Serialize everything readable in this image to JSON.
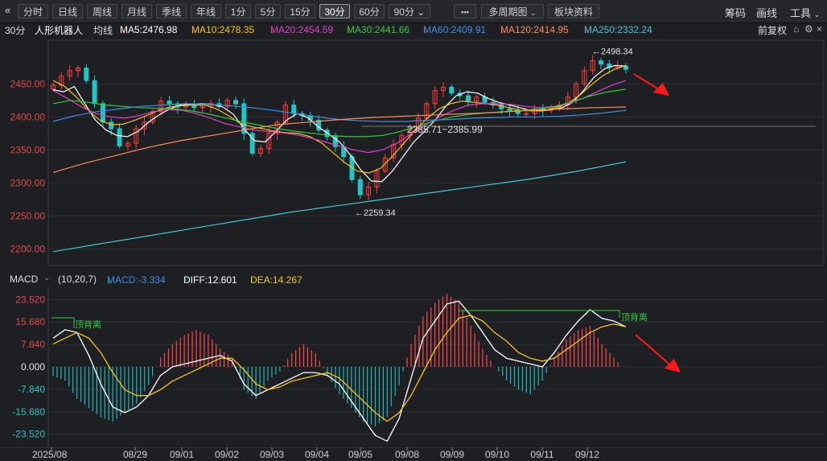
{
  "toolbar": {
    "collapse_icon": "double-chevron-left-icon",
    "periods": [
      "分时",
      "日线",
      "周线",
      "月线",
      "季线",
      "年线",
      "1分",
      "5分",
      "15分",
      "30分",
      "60分",
      "90分"
    ],
    "active_period": "30分",
    "more_label": "▪▪▪",
    "multi_period": "多周期图",
    "sector_info": "板块资料",
    "right": [
      "筹码",
      "画线",
      "工具"
    ]
  },
  "info": {
    "period": "30分",
    "name": "人形机器人",
    "ma_label": "均线",
    "ma": [
      {
        "label": "MA5:2476.98",
        "color": "#ffffff",
        "arrow": "↑"
      },
      {
        "label": "MA10:2478.35",
        "color": "#f5c518",
        "arrow": "↑"
      },
      {
        "label": "MA20:2454.59",
        "color": "#e040c8",
        "arrow": "↑"
      },
      {
        "label": "MA30:2441.66",
        "color": "#2ecc40",
        "arrow": "↑"
      },
      {
        "label": "MA60:2409.91",
        "color": "#3a8ee6",
        "arrow": "↑"
      },
      {
        "label": "MA120:2414.95",
        "color": "#ff8c5a",
        "arrow": "↑"
      },
      {
        "label": "MA250:2332.24",
        "color": "#40c8d8",
        "arrow": "↑"
      }
    ],
    "adjust": "前复权"
  },
  "macd": {
    "name": "MACD",
    "params": "(10,20,7)",
    "macd": "MACD:-3.334",
    "macd_arrow": "↓",
    "diff": "DIFF:12.601",
    "diff_arrow": "↓",
    "dea": "DEA:14.267",
    "dea_arrow": "↓"
  },
  "annotations": {
    "high": "←2498.34",
    "low": "←2259.34",
    "mid": "2385.71~2385.99",
    "top_div_1": "顶背离",
    "top_div_2": "顶背离"
  },
  "colors": {
    "up": "#ff3b3b",
    "down": "#22c5c5",
    "bg": "#1e1f23",
    "grid": "#2e2f35"
  },
  "chart_data": [
    {
      "type": "candlestick",
      "title": "30分 人形机器人",
      "yticks": [
        "2450.00",
        "2400.00",
        "2350.00",
        "2300.00",
        "2250.00",
        "2200.00"
      ],
      "yvals": [
        2450,
        2400,
        2350,
        2300,
        2250,
        2200
      ],
      "ylim": [
        2175,
        2510
      ],
      "xticks": [
        "2025/08",
        "08/29",
        "09/01",
        "09/02",
        "09/03",
        "09/04",
        "09/05",
        "09/08",
        "09/09",
        "09/10",
        "09/11",
        "09/12"
      ],
      "high_label_value": 2498.34,
      "low_label_value": 2259.34,
      "close_path": [
        2448,
        2462,
        2470,
        2474,
        2455,
        2420,
        2392,
        2382,
        2356,
        2360,
        2382,
        2392,
        2408,
        2424,
        2420,
        2415,
        2418,
        2414,
        2416,
        2420,
        2416,
        2425,
        2420,
        2375,
        2345,
        2352,
        2375,
        2392,
        2418,
        2405,
        2402,
        2395,
        2380,
        2370,
        2355,
        2340,
        2305,
        2282,
        2294,
        2318,
        2338,
        2358,
        2372,
        2382,
        2398,
        2420,
        2440,
        2445,
        2436,
        2432,
        2424,
        2430,
        2422,
        2418,
        2412,
        2410,
        2405,
        2405,
        2412,
        2410,
        2415,
        2418,
        2430,
        2450,
        2470,
        2485,
        2480,
        2475,
        2477,
        2472
      ],
      "ma_series": [
        {
          "name": "MA5",
          "values": [
            2441,
            2438,
            2446,
            2420,
            2395,
            2380,
            2372,
            2370,
            2378,
            2392,
            2403,
            2412,
            2418,
            2419,
            2420,
            2419,
            2415,
            2404,
            2382,
            2364,
            2362,
            2378,
            2395,
            2405,
            2399,
            2385,
            2374,
            2362,
            2343,
            2320,
            2303,
            2302,
            2318,
            2340,
            2362,
            2378,
            2395,
            2416,
            2432,
            2438,
            2436,
            2428,
            2422,
            2418,
            2414,
            2410,
            2409,
            2411,
            2414,
            2422,
            2440,
            2460,
            2473,
            2478,
            2477
          ],
          "xr": [
            0.0,
            1.0
          ]
        },
        {
          "name": "MA10",
          "values": [
            2455,
            2446,
            2430,
            2410,
            2395,
            2388,
            2389,
            2395,
            2402,
            2410,
            2415,
            2417,
            2418,
            2418,
            2412,
            2402,
            2390,
            2385,
            2382,
            2378,
            2376,
            2375,
            2370,
            2360,
            2345,
            2330,
            2318,
            2315,
            2322,
            2340,
            2360,
            2380,
            2398,
            2412,
            2420,
            2424,
            2422,
            2420,
            2418,
            2414,
            2410,
            2409,
            2410,
            2414,
            2420,
            2432,
            2448,
            2462,
            2472,
            2478
          ],
          "xr": [
            0.0,
            1.0
          ]
        },
        {
          "name": "MA20",
          "values": [
            2440,
            2428,
            2415,
            2405,
            2400,
            2398,
            2402,
            2408,
            2411,
            2410,
            2405,
            2398,
            2390,
            2385,
            2380,
            2378,
            2376,
            2373,
            2368,
            2362,
            2356,
            2350,
            2346,
            2350,
            2360,
            2374,
            2388,
            2400,
            2410,
            2418,
            2420,
            2420,
            2419,
            2416,
            2414,
            2416,
            2420,
            2428,
            2438,
            2448,
            2455
          ],
          "xr": [
            0.0,
            1.0
          ]
        },
        {
          "name": "MA30",
          "values": [
            2420,
            2425,
            2422,
            2418,
            2416,
            2414,
            2413,
            2412,
            2409,
            2404,
            2398,
            2392,
            2387,
            2382,
            2378,
            2375,
            2372,
            2370,
            2370,
            2372,
            2378,
            2386,
            2394,
            2400,
            2404,
            2406,
            2408,
            2410,
            2412,
            2416,
            2424,
            2432,
            2438,
            2442
          ],
          "xr": [
            0.0,
            1.0
          ]
        },
        {
          "name": "MA60",
          "values": [
            2393,
            2402,
            2408,
            2412,
            2416,
            2418,
            2420,
            2419,
            2417,
            2414,
            2410,
            2405,
            2400,
            2396,
            2394,
            2393,
            2393,
            2395,
            2396,
            2398,
            2399,
            2400,
            2400,
            2401,
            2403,
            2406,
            2410
          ],
          "xr": [
            0.0,
            1.0
          ]
        },
        {
          "name": "MA120",
          "values": [
            2316,
            2330,
            2342,
            2354,
            2364,
            2372,
            2380,
            2388,
            2392,
            2396,
            2399,
            2401,
            2403,
            2405,
            2407,
            2410,
            2412,
            2414,
            2415
          ],
          "xr": [
            0.0,
            1.0
          ]
        },
        {
          "name": "MA250",
          "values": [
            2196,
            2208,
            2220,
            2232,
            2244,
            2256,
            2266,
            2276,
            2286,
            2296,
            2306,
            2318,
            2332
          ],
          "xr": [
            0.0,
            1.0
          ]
        }
      ]
    },
    {
      "type": "macd",
      "title": "MACD (10,20,7)",
      "yticks": [
        "23.520",
        "15.680",
        "7.840",
        "0.000",
        "-7.840",
        "-15.680",
        "-23.520"
      ],
      "yvals": [
        23.52,
        15.68,
        7.84,
        0,
        -7.84,
        -15.68,
        -23.52
      ],
      "ylim": [
        -27,
        27
      ],
      "diff": [
        10,
        13,
        12,
        4,
        -6,
        -14,
        -16,
        -14,
        -10,
        -3,
        0,
        1,
        2,
        3,
        4,
        2,
        -6,
        -10,
        -8,
        -6,
        -4,
        -2,
        -2,
        -3,
        -6,
        -12,
        -18,
        -24,
        -26,
        -18,
        -4,
        10,
        16,
        22,
        23,
        18,
        12,
        6,
        3,
        2,
        1,
        0,
        5,
        11,
        16,
        20,
        17,
        16,
        14
      ],
      "dea": [
        8,
        10,
        12,
        10,
        5,
        -2,
        -8,
        -10,
        -10,
        -8,
        -5,
        -3,
        -1,
        1,
        3,
        3,
        -1,
        -6,
        -8,
        -7,
        -5,
        -4,
        -3,
        -2,
        -4,
        -8,
        -12,
        -16,
        -19,
        -16,
        -10,
        -2,
        6,
        12,
        17,
        18,
        16,
        12,
        9,
        5,
        3,
        2,
        3,
        6,
        9,
        12,
        14,
        15,
        14
      ],
      "hist": [
        -2,
        -3,
        -7,
        -9,
        -11,
        -12,
        -10,
        -8,
        -4,
        2,
        5,
        7,
        8,
        7,
        4,
        2,
        -5,
        -7,
        -3,
        -1,
        3,
        5,
        3,
        -2,
        -6,
        -9,
        -12,
        -13,
        -11,
        -4,
        5,
        11,
        14,
        16,
        14,
        9,
        4,
        0,
        -3,
        -5,
        -6,
        -3,
        2,
        6,
        8,
        9,
        5,
        2,
        -1
      ]
    }
  ]
}
